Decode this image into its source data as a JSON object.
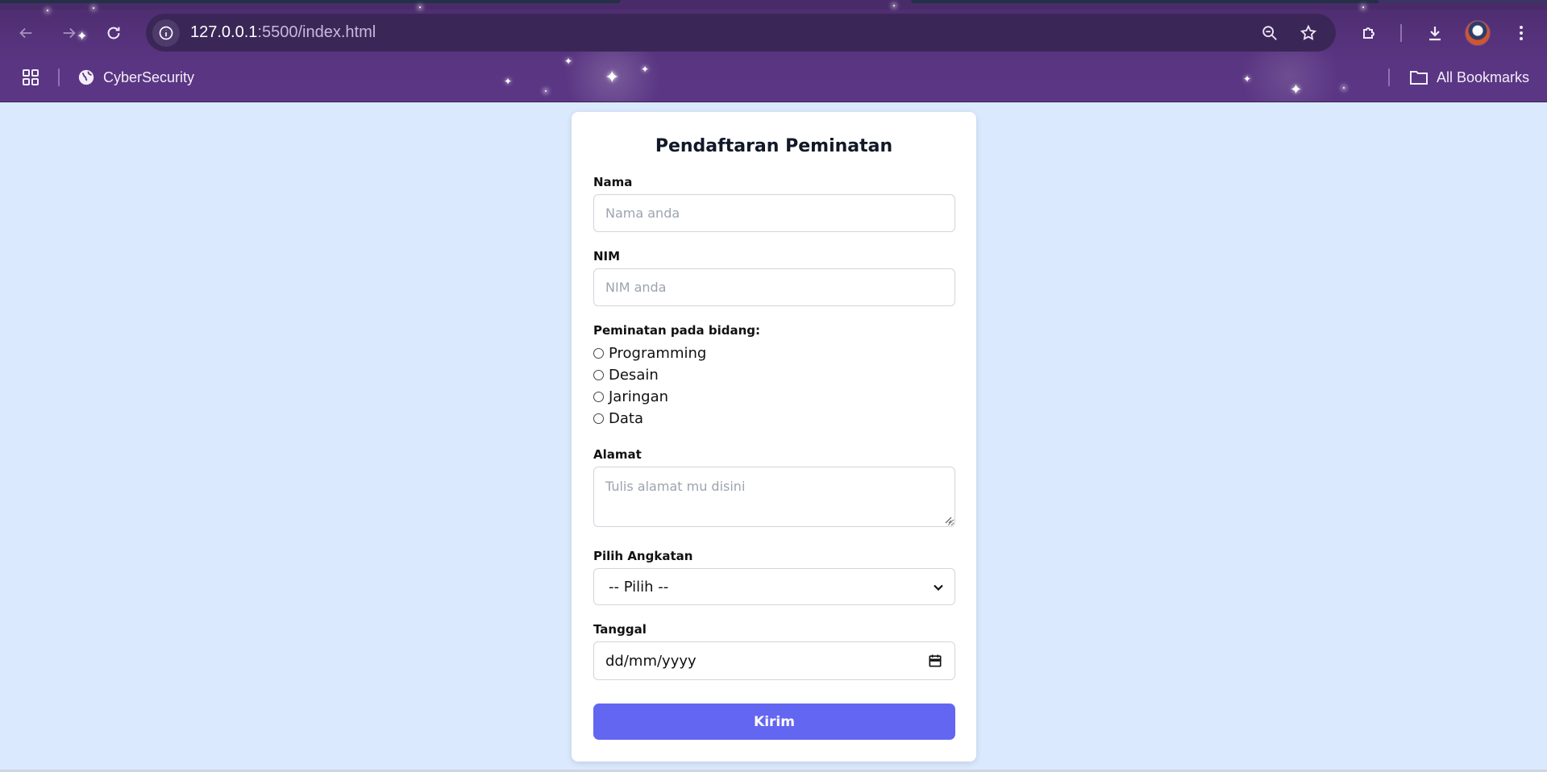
{
  "browser": {
    "url_host": "127.0.0.1",
    "url_path": ":5500/index.html",
    "bookmarks": {
      "item_label": "CyberSecurity",
      "all_bookmarks_label": "All Bookmarks"
    },
    "icons": {
      "back": "arrow-left-icon",
      "forward": "arrow-right-icon",
      "reload": "reload-icon",
      "site_info": "info-icon",
      "zoom": "zoom-out-icon",
      "star": "star-icon",
      "extensions": "puzzle-icon",
      "download": "download-icon",
      "menu": "kebab-menu-icon",
      "apps": "apps-grid-icon",
      "globe": "globe-icon",
      "folder": "folder-icon"
    }
  },
  "form": {
    "title": "Pendaftaran Peminatan",
    "nama_label": "Nama",
    "nama_placeholder": "Nama anda",
    "nim_label": "NIM",
    "nim_placeholder": "NIM anda",
    "peminatan_label": "Peminatan pada bidang:",
    "peminatan_options": [
      "Programming",
      "Desain",
      "Jaringan",
      "Data"
    ],
    "alamat_label": "Alamat",
    "alamat_placeholder": "Tulis alamat mu disini",
    "angkatan_label": "Pilih Angkatan",
    "angkatan_selected": "-- Pilih --",
    "tanggal_label": "Tanggal",
    "tanggal_placeholder": "dd/mm/yyyy",
    "submit_label": "Kirim"
  },
  "colors": {
    "page_background": "#dbe9fe",
    "chrome_background": "#5a3582",
    "submit_button": "#6366f1"
  }
}
